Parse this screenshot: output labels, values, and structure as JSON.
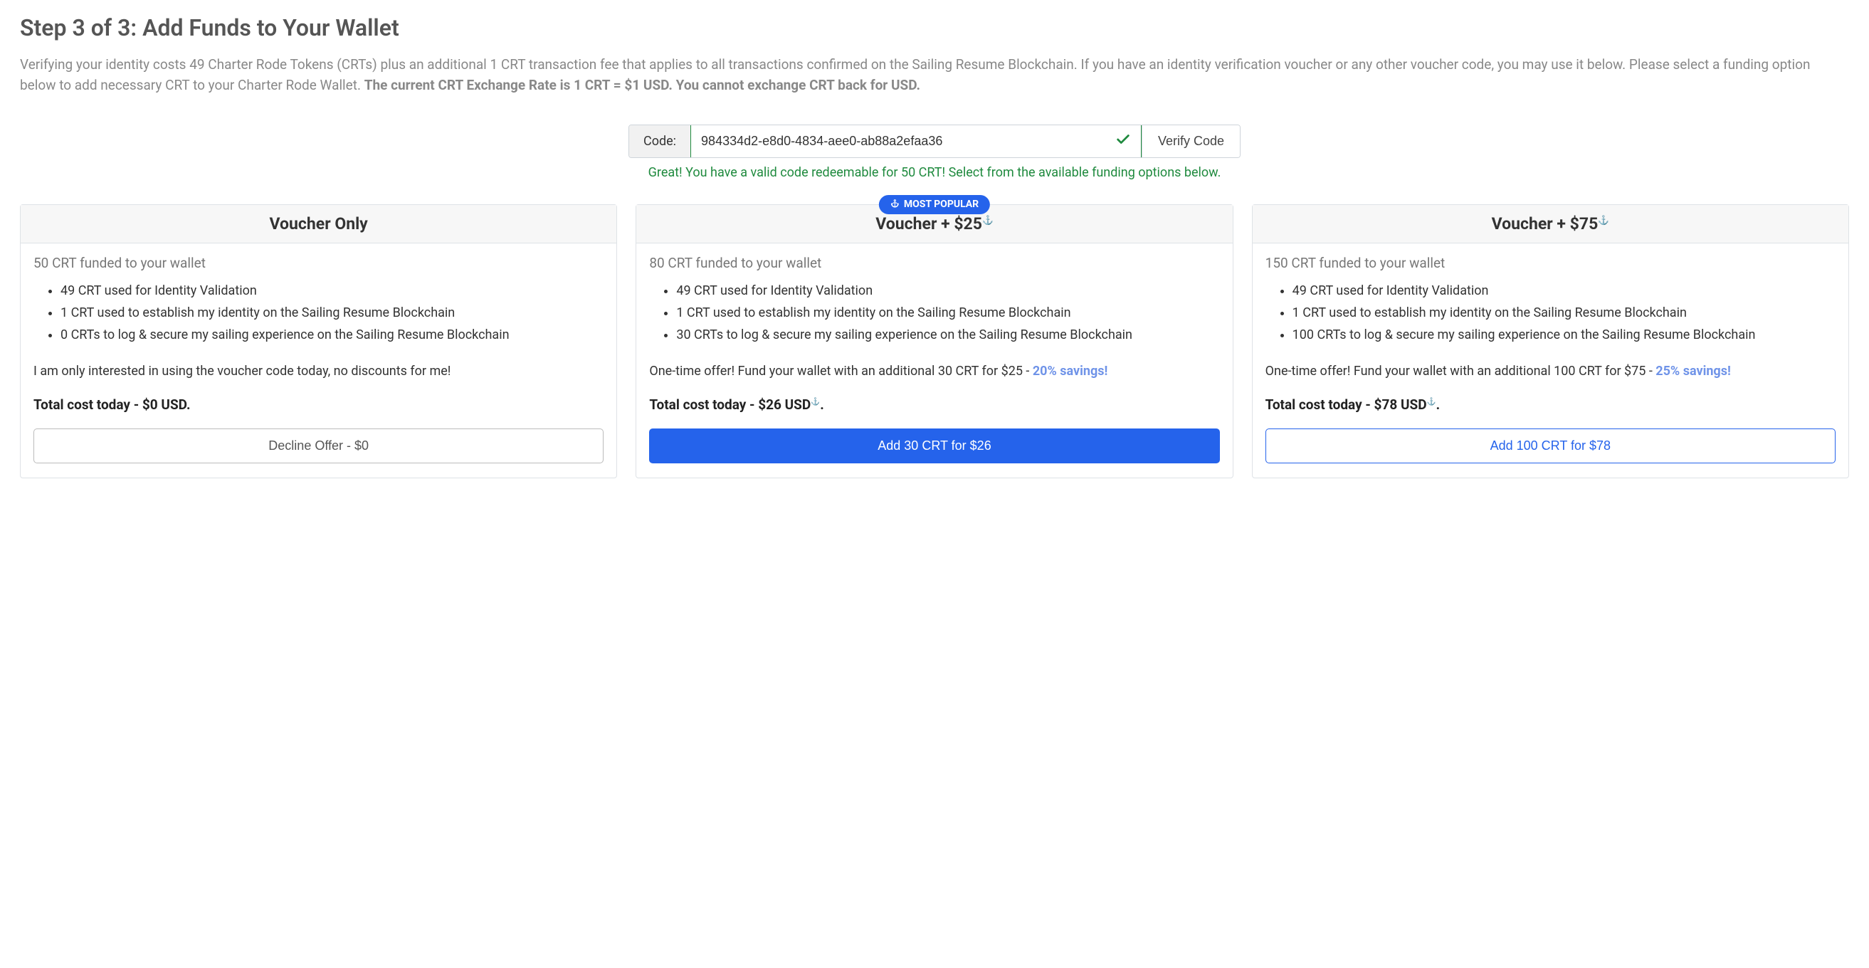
{
  "header": {
    "title": "Step 3 of 3: Add Funds to Your Wallet",
    "intro_part1": "Verifying your identity costs 49 Charter Rode Tokens (CRTs) plus an additional 1 CRT transaction fee that applies to all transactions confirmed on the Sailing Resume Blockchain. If you have an identity verification voucher or any other voucher code, you may use it below. Please select a funding option below to add necessary CRT to your Charter Rode Wallet. ",
    "intro_bold1": "The current CRT Exchange Rate is 1 CRT = $1 USD.",
    "intro_bold2": " You cannot exchange CRT back for USD."
  },
  "code": {
    "label": "Code:",
    "value": "984334d2-e8d0-4834-aee0-ab88a2efaa36",
    "verify_label": "Verify Code",
    "success_msg": "Great! You have a valid code redeemable for 50 CRT! Select from the available funding options below."
  },
  "badge_label": "MOST POPULAR",
  "cards": [
    {
      "title": "Voucher Only",
      "has_anchor": false,
      "funded": "50 CRT funded to your wallet",
      "bullets": [
        "49 CRT used for Identity Validation",
        "1 CRT used to establish my identity on the Sailing Resume Blockchain",
        "0 CRTs to log & secure my sailing experience on the Sailing Resume Blockchain"
      ],
      "offer_pre": "I am only interested in using the voucher code today, no discounts for me!",
      "savings": "",
      "total_pre": "Total cost today - $0 USD",
      "total_has_anchor": false,
      "cta": "Decline Offer - $0"
    },
    {
      "title": "Voucher + $25",
      "has_anchor": true,
      "funded": "80 CRT funded to your wallet",
      "bullets": [
        "49 CRT used for Identity Validation",
        "1 CRT used to establish my identity on the Sailing Resume Blockchain",
        "30 CRTs to log & secure my sailing experience on the Sailing Resume Blockchain"
      ],
      "offer_pre": "One-time offer! Fund your wallet with an additional 30 CRT for $25 - ",
      "savings": "20% savings!",
      "total_pre": "Total cost today - $26 USD",
      "total_has_anchor": true,
      "cta": "Add 30 CRT for $26"
    },
    {
      "title": "Voucher + $75",
      "has_anchor": true,
      "funded": "150 CRT funded to your wallet",
      "bullets": [
        "49 CRT used for Identity Validation",
        "1 CRT used to establish my identity on the Sailing Resume Blockchain",
        "100 CRTs to log & secure my sailing experience on the Sailing Resume Blockchain"
      ],
      "offer_pre": "One-time offer! Fund your wallet with an additional 100 CRT for $75 - ",
      "savings": "25% savings!",
      "total_pre": "Total cost today - $78 USD",
      "total_has_anchor": true,
      "cta": "Add 100 CRT for $78"
    }
  ]
}
